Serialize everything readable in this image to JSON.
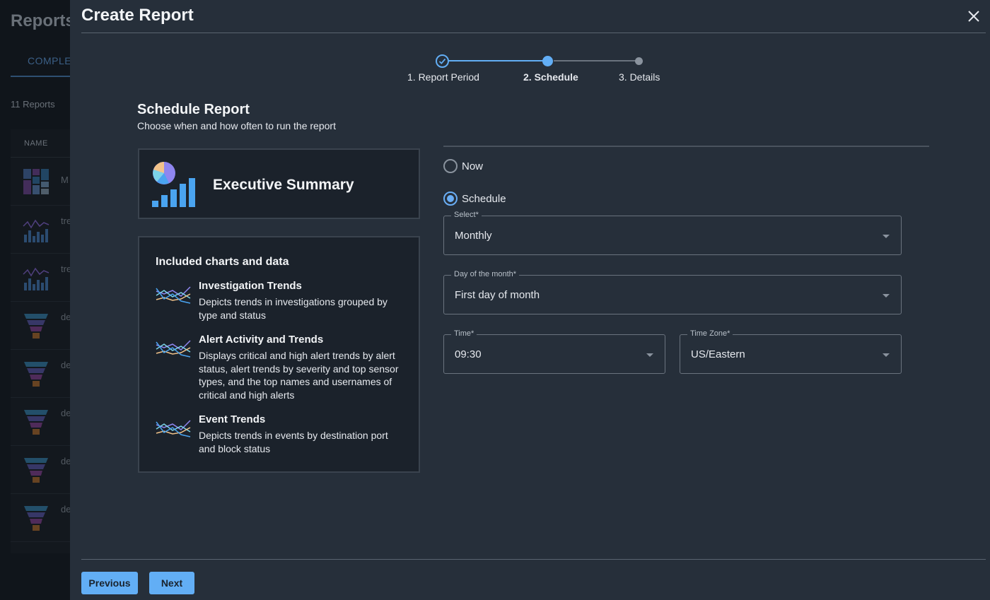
{
  "background": {
    "page_title": "Reports",
    "tab_label": "COMPLE",
    "report_count": "11 Reports",
    "table_header": "NAME",
    "rows": [
      {
        "text": "M",
        "icon": "treemap-icon"
      },
      {
        "text": "tre",
        "icon": "trend-chart-icon"
      },
      {
        "text": "tre",
        "icon": "trend-chart-icon"
      },
      {
        "text": "de",
        "icon": "funnel-icon"
      },
      {
        "text": "de",
        "icon": "funnel-icon"
      },
      {
        "text": "de",
        "icon": "funnel-icon"
      },
      {
        "text": "de",
        "icon": "funnel-icon"
      },
      {
        "text": "de",
        "icon": "funnel-icon"
      }
    ]
  },
  "modal": {
    "title": "Create Report",
    "close_icon": "close-icon",
    "stepper": {
      "steps": [
        "1. Report Period",
        "2. Schedule",
        "3. Details"
      ],
      "active_index": 1
    },
    "section_title": "Schedule Report",
    "section_subtitle": "Choose when and how often to run the report",
    "report_card": {
      "title": "Executive Summary",
      "icon": "executive-summary-icon"
    },
    "included": {
      "heading": "Included charts and data",
      "items": [
        {
          "title": "Investigation Trends",
          "description": "Depicts trends in investigations grouped by type and status"
        },
        {
          "title": "Alert Activity and Trends",
          "description": "Displays critical and high alert trends by alert status, alert trends by severity and top sensor types, and the top names and usernames of critical and high alerts"
        },
        {
          "title": "Event Trends",
          "description": "Depicts trends in events by destination port and block status"
        }
      ]
    },
    "form": {
      "radio_now": "Now",
      "radio_schedule": "Schedule",
      "selected_radio": "Schedule",
      "frequency": {
        "label": "Select*",
        "value": "Monthly"
      },
      "day_of_month": {
        "label": "Day of the month*",
        "value": "First day of month"
      },
      "time": {
        "label": "Time*",
        "value": "09:30"
      },
      "time_zone": {
        "label": "Time Zone*",
        "value": "US/Eastern"
      }
    },
    "buttons": {
      "previous": "Previous",
      "next": "Next"
    }
  },
  "colors": {
    "accent": "#62aef5",
    "modal_bg": "#262f3a",
    "card_bg": "#1b222b"
  }
}
